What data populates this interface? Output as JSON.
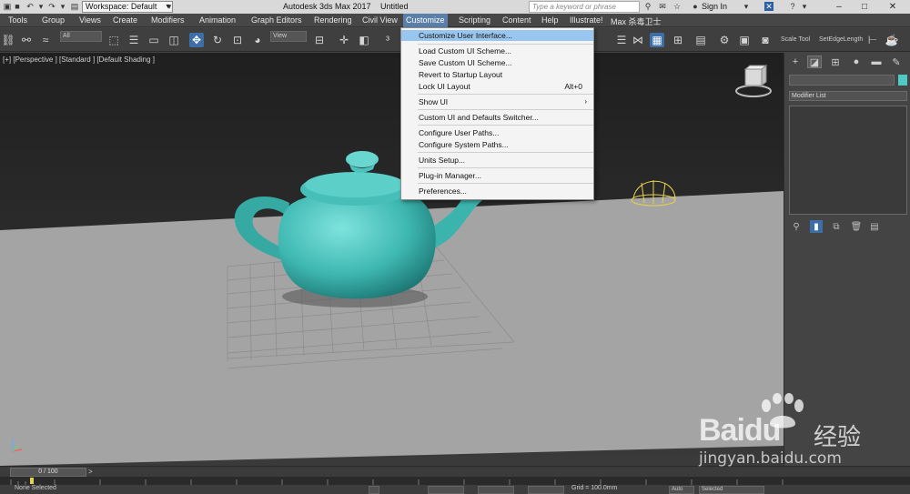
{
  "titlebar": {
    "workspace_label": "Workspace: Default",
    "app_title": "Autodesk 3ds Max 2017",
    "doc_title": "Untitled",
    "search_placeholder": "Type a keyword or phrase",
    "signin_label": "Sign In"
  },
  "menubar": {
    "items": [
      "Tools",
      "Group",
      "Views",
      "Create",
      "Modifiers",
      "Animation",
      "Graph Editors",
      "Rendering",
      "Civil View",
      "Customize",
      "Scripting",
      "Content",
      "Help",
      "Illustrate!",
      "Max 杀毒卫士"
    ],
    "active": "Customize"
  },
  "toolbar": {
    "selection_filter": "All",
    "ref_coord": "View",
    "scale_tool_label": "Scale Tool",
    "set_edge_length_label": "SetEdgeLength"
  },
  "viewport": {
    "label": "[+] [Perspective ] [Standard ] [Default Shading ]",
    "teapot_color": "#4fc9c4"
  },
  "customize_menu": {
    "items": [
      {
        "label": "Customize User Interface...",
        "highlighted": true
      },
      {
        "label": "Load Custom UI Scheme..."
      },
      {
        "label": "Save Custom UI Scheme..."
      },
      {
        "label": "Revert to Startup Layout"
      },
      {
        "label": "Lock UI Layout",
        "shortcut": "Alt+0"
      },
      {
        "label": "Show UI",
        "submenu": true
      },
      {
        "label": "Custom UI and Defaults Switcher..."
      },
      {
        "label": "Configure User Paths..."
      },
      {
        "label": "Configure System Paths..."
      },
      {
        "label": "Units Setup..."
      },
      {
        "label": "Plug-in Manager..."
      },
      {
        "label": "Preferences..."
      }
    ]
  },
  "command_panel": {
    "modifier_list_label": "Modifier List"
  },
  "timeline": {
    "frame_label": "0 / 100"
  },
  "status": {
    "selection_text": "None Selected",
    "grid_text": "Grid = 100.0mm",
    "key_mode": "Auto",
    "key_filter": "Selected"
  },
  "watermark": {
    "brand": "Baidu",
    "brand_cn": "经验",
    "url": "jingyan.baidu.com"
  }
}
